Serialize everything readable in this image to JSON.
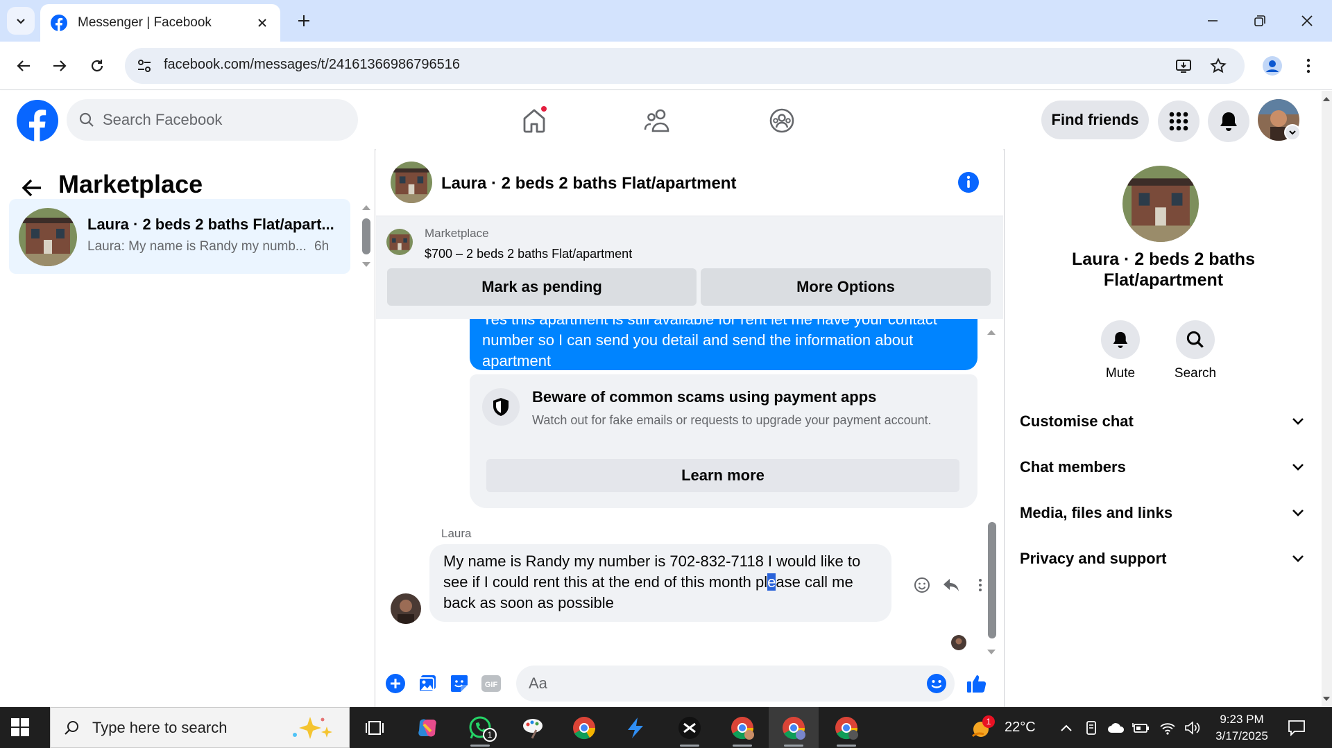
{
  "browser": {
    "tab_title": "Messenger | Facebook",
    "url": "facebook.com/messages/t/24161366986796516"
  },
  "fb": {
    "search_placeholder": "Search Facebook",
    "find_friends": "Find friends"
  },
  "sidebar": {
    "title": "Marketplace",
    "conversations": [
      {
        "name": "Laura · 2 beds 2 baths Flat/apart...",
        "preview": "Laura: My name is Randy my numb...",
        "time": "6h"
      }
    ]
  },
  "chat": {
    "title": "Laura · 2 beds 2 baths Flat/apartment",
    "listing": {
      "label": "Marketplace",
      "title": "$700 – 2 beds 2 baths Flat/apartment",
      "mark_pending": "Mark as pending",
      "more_options": "More Options"
    },
    "outgoing_message": "Yes this apartment is still available for rent let me have your contact number so I can send you detail and send the information about apartment",
    "scam_notice": {
      "title": "Beware of common scams using payment apps",
      "text": "Watch out for fake emails or requests to upgrade your payment account.",
      "button": "Learn more"
    },
    "incoming": {
      "sender": "Laura",
      "text_before": "My name is Randy my number is 702-832-7118 I would like to see if I could rent this at the end of this month pl",
      "text_selected": "e",
      "text_after": "ase call me back as soon as possible"
    },
    "composer_placeholder": "Aa"
  },
  "right_panel": {
    "name": "Laura · 2 beds 2 baths Flat/apartment",
    "actions": [
      "Mute",
      "Search"
    ],
    "sections": [
      "Customise chat",
      "Chat members",
      "Media, files and links",
      "Privacy and support"
    ]
  },
  "taskbar": {
    "search_placeholder": "Type here to search",
    "whatsapp_badge": "1",
    "weather_badge": "1",
    "temperature": "22°C",
    "time": "9:23 PM",
    "date": "3/17/2025"
  },
  "colors": {
    "fb_blue": "#0866ff",
    "messenger_blue": "#0084ff",
    "notification_red": "#e41e3f"
  }
}
